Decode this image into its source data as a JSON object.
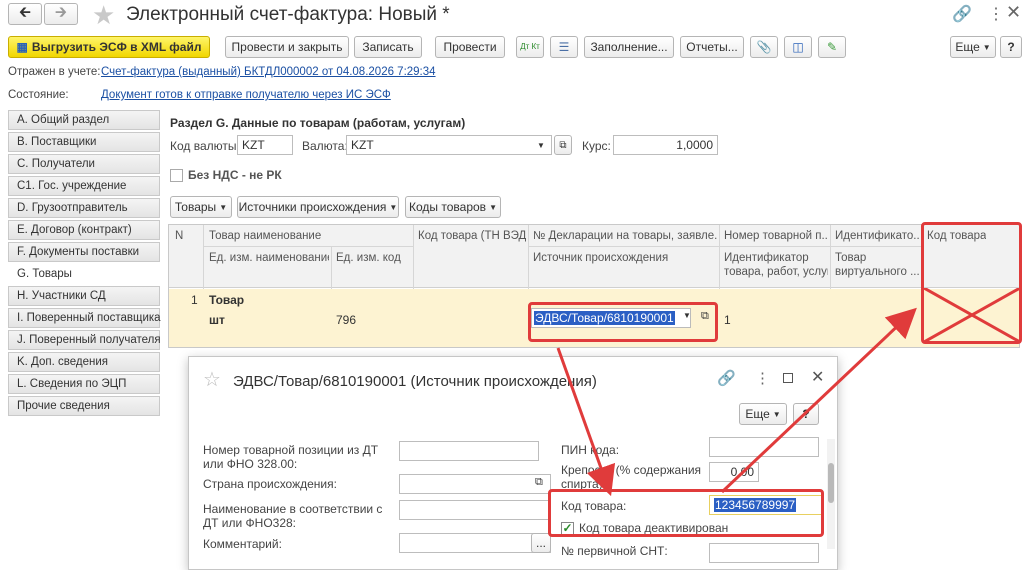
{
  "window": {
    "title": "Электронный счет-фактура:  Новый *"
  },
  "toolbar": {
    "export_label": "Выгрузить ЭСФ в XML файл",
    "post_close_label": "Провести и закрыть",
    "write_label": "Записать",
    "post_label": "Провести",
    "fill_label": "Заполнение...",
    "reports_label": "Отчеты...",
    "more_label": "Еще",
    "dtkt_label": "Дт Кт",
    "help_label": "?"
  },
  "info": {
    "reflected_label": "Отражен в учете:",
    "reflected_link": "Счет-фактура (выданный) БКТДЛ000002 от 04.08.2026 7:29:34",
    "state_label": "Состояние:",
    "state_link": "Документ готов к отправке получателю через ИС ЭСФ"
  },
  "sidebar": {
    "items": [
      {
        "label": "A. Общий раздел"
      },
      {
        "label": "B. Поставщики"
      },
      {
        "label": "C. Получатели"
      },
      {
        "label": "C1. Гос. учреждение"
      },
      {
        "label": "D. Грузоотправитель"
      },
      {
        "label": "E. Договор (контракт)"
      },
      {
        "label": "F. Документы поставки"
      },
      {
        "label": "G. Товары"
      },
      {
        "label": "H. Участники СД"
      },
      {
        "label": "I. Поверенный поставщика"
      },
      {
        "label": "J. Поверенный получателя"
      },
      {
        "label": "K. Доп. сведения"
      },
      {
        "label": "L. Сведения по ЭЦП"
      },
      {
        "label": "Прочие сведения"
      }
    ]
  },
  "section": {
    "title": "Раздел G. Данные по товарам (работам, услугам)",
    "currency_code_label": "Код валюты:",
    "currency_code_value": "KZT",
    "currency_label": "Валюта:",
    "currency_value": "KZT",
    "rate_label": "Курс:",
    "rate_value": "1,0000",
    "no_vat_label": "Без НДС - не РК",
    "goods_btn": "Товары",
    "origins_btn": "Источники происхождения",
    "codes_btn": "Коды товаров"
  },
  "table": {
    "headers": {
      "n": "N",
      "name": "Товар наименование",
      "unit_name": "Ед. изм. наименование",
      "unit_code": "Ед. изм. код",
      "tnved": "Код товара (ТН ВЭД)",
      "decl": "№ Декларации на товары, заявле...",
      "origin": "Источник происхождения",
      "pos": "Номер товарной п...",
      "ident_a": "Идентификатор",
      "ident_b": "товара, работ, услуг",
      "id2_a": "Идентификато...",
      "id2_b": "Товар",
      "id2_c": "виртуального ...",
      "code": "Код товара"
    },
    "row": {
      "n": "1",
      "name": "Товар",
      "unit": "шт",
      "unit_code": "796",
      "origin": "ЭДВС/Товар/6810190001",
      "ident": "1"
    }
  },
  "dialog": {
    "title": "ЭДВС/Товар/6810190001 (Источник происхождения)",
    "more_label": "Еще",
    "help_label": "?",
    "pos_label": "Номер товарной позиции из ДТ или ФНО 328.00:",
    "country_label": "Страна происхождения:",
    "name_label": "Наименование в соответствии с ДТ или ФНО328:",
    "comment_label": "Комментарий:",
    "pin_label": "ПИН кода:",
    "strength_label": "Крепость (% содержания спирта):",
    "strength_value": "0,00",
    "code_label": "Код товара:",
    "code_value": "123456789997",
    "deactivated_label": "Код товара деактивирован",
    "snt_label": "№ первичной СНТ:"
  },
  "colors": {
    "accent_red": "#e03b3b",
    "row_highlight": "#fdf3d2",
    "link": "#1a4fa3"
  }
}
